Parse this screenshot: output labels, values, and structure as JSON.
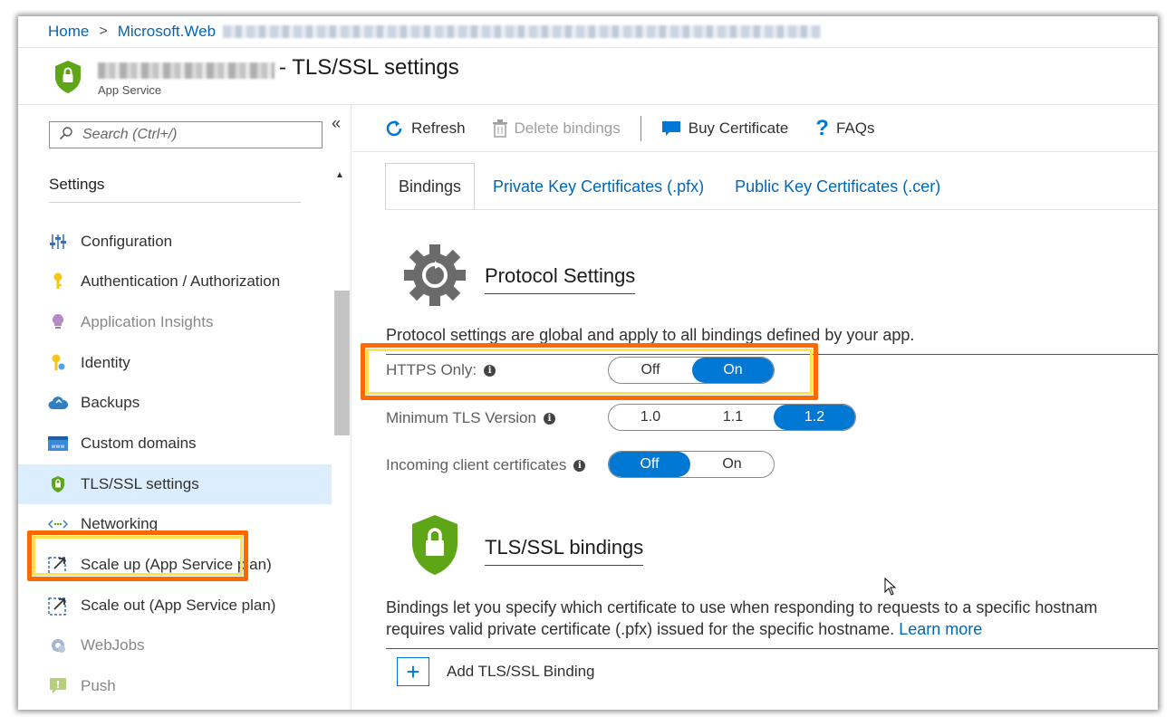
{
  "breadcrumb": {
    "home": "Home",
    "separator": ">",
    "resource": "Microsoft.Web"
  },
  "header": {
    "title": "- TLS/SSL settings",
    "subtitle": "App Service"
  },
  "sidebar": {
    "search_placeholder": "Search (Ctrl+/)",
    "collapse_label": "«",
    "section": "Settings",
    "items": [
      {
        "label": "Configuration",
        "icon": "configuration-sliders-icon"
      },
      {
        "label": "Authentication / Authorization",
        "icon": "key-icon"
      },
      {
        "label": "Application Insights",
        "icon": "lightbulb-icon"
      },
      {
        "label": "Identity",
        "icon": "identity-key-icon"
      },
      {
        "label": "Backups",
        "icon": "cloud-backup-icon"
      },
      {
        "label": "Custom domains",
        "icon": "www-icon"
      },
      {
        "label": "TLS/SSL settings",
        "icon": "shield-lock-icon"
      },
      {
        "label": "Networking",
        "icon": "network-arrows-icon"
      },
      {
        "label": "Scale up (App Service plan)",
        "icon": "scale-up-icon"
      },
      {
        "label": "Scale out (App Service plan)",
        "icon": "scale-out-icon"
      },
      {
        "label": "WebJobs",
        "icon": "webjobs-gear-icon"
      },
      {
        "label": "Push",
        "icon": "push-notification-icon"
      }
    ]
  },
  "toolbar": {
    "refresh": "Refresh",
    "delete_bindings": "Delete bindings",
    "buy_certificate": "Buy Certificate",
    "faqs": "FAQs"
  },
  "tabs": [
    "Bindings",
    "Private Key Certificates (.pfx)",
    "Public Key Certificates (.cer)"
  ],
  "protocol": {
    "heading": "Protocol Settings",
    "description": "Protocol settings are global and apply to all bindings defined by your app.",
    "https_only": {
      "label": "HTTPS Only:",
      "options": [
        "Off",
        "On"
      ],
      "selected": "On"
    },
    "min_tls": {
      "label": "Minimum TLS Version",
      "options": [
        "1.0",
        "1.1",
        "1.2"
      ],
      "selected": "1.2"
    },
    "client_certs": {
      "label": "Incoming client certificates",
      "options": [
        "Off",
        "On"
      ],
      "selected": "Off"
    }
  },
  "bindings": {
    "heading": "TLS/SSL bindings",
    "description_line1": "Bindings let you specify which certificate to use when responding to requests to a specific hostnam",
    "description_line2": "requires valid private certificate (.pfx) issued for the specific hostname.",
    "learn_more": "Learn more",
    "add_label": "Add TLS/SSL Binding"
  },
  "colors": {
    "accent": "#0078d4",
    "link": "#0067b8",
    "highlight": "#ff6a00",
    "shield_green": "#5ea517"
  }
}
